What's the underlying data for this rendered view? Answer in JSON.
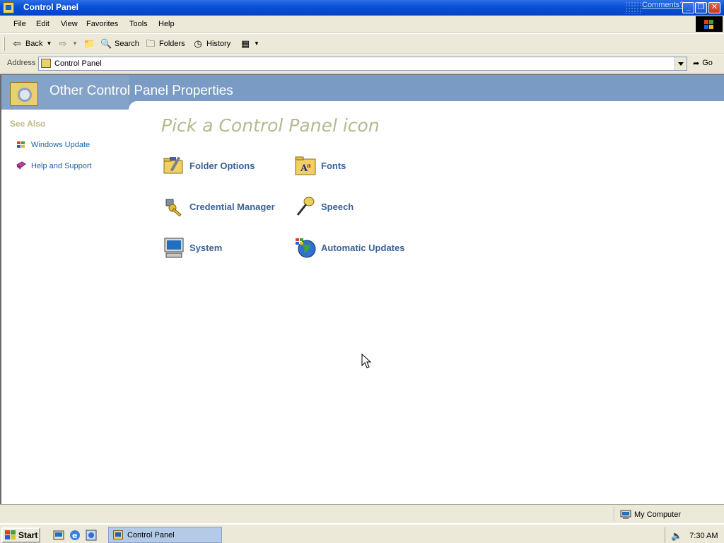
{
  "window": {
    "title": "Control Panel",
    "comments_link": "Comments?",
    "minimize": "_",
    "restore": "❐",
    "close": "✕"
  },
  "menu": {
    "items": [
      "File",
      "Edit",
      "View",
      "Favorites",
      "Tools",
      "Help"
    ]
  },
  "toolbar": {
    "back": "Back",
    "search": "Search",
    "folders": "Folders",
    "history": "History"
  },
  "address": {
    "label": "Address",
    "value": "Control Panel",
    "go": "Go"
  },
  "banner": {
    "title": "Other Control Panel Properties"
  },
  "see_also": {
    "header": "See Also",
    "links": [
      {
        "label": "Windows Update",
        "icon": "windows-update-icon"
      },
      {
        "label": "Help and Support",
        "icon": "help-book-icon"
      }
    ]
  },
  "main": {
    "heading": "Pick a Control Panel icon",
    "items": [
      {
        "label": "Folder Options",
        "icon": "folder-options-icon"
      },
      {
        "label": "Fonts",
        "icon": "fonts-folder-icon"
      },
      {
        "label": "Credential Manager",
        "icon": "credential-manager-icon"
      },
      {
        "label": "Speech",
        "icon": "microphone-icon"
      },
      {
        "label": "System",
        "icon": "computer-icon"
      },
      {
        "label": "Automatic Updates",
        "icon": "globe-icon"
      }
    ]
  },
  "statusbar": {
    "zone": "My Computer"
  },
  "taskbar": {
    "start": "Start",
    "task": "Control Panel",
    "clock": "7:30 AM"
  }
}
